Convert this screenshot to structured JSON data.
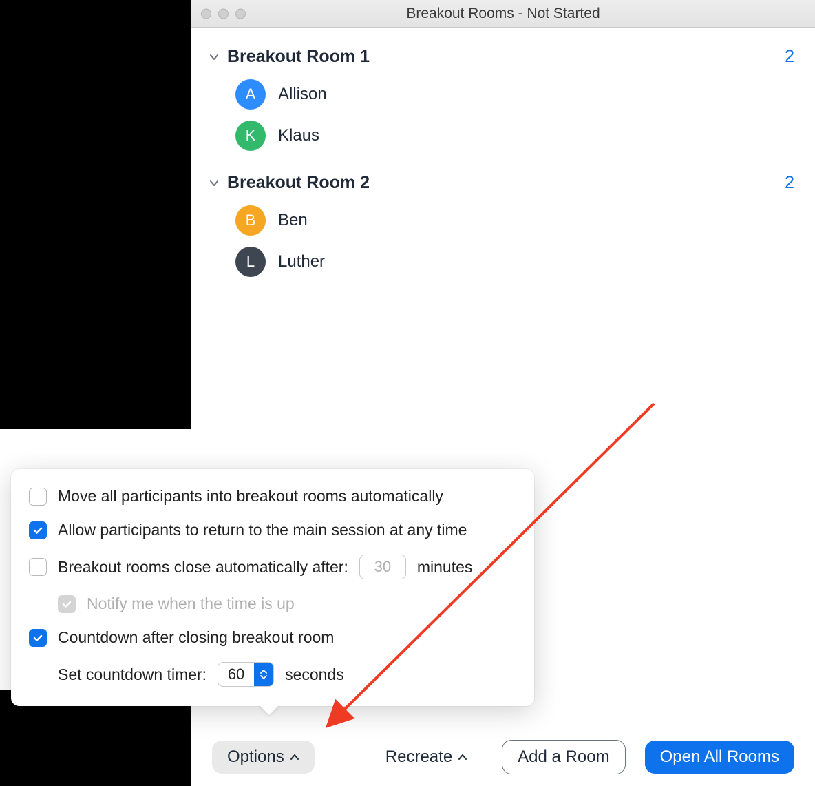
{
  "window": {
    "title": "Breakout Rooms - Not Started"
  },
  "rooms": [
    {
      "name": "Breakout Room 1",
      "count": "2",
      "participants": [
        {
          "initial": "A",
          "name": "Allison",
          "color": "#2d8cff"
        },
        {
          "initial": "K",
          "name": "Klaus",
          "color": "#32b96c"
        }
      ]
    },
    {
      "name": "Breakout Room 2",
      "count": "2",
      "participants": [
        {
          "initial": "B",
          "name": "Ben",
          "color": "#f5a623"
        },
        {
          "initial": "L",
          "name": "Luther",
          "color": "#3d4651"
        }
      ]
    }
  ],
  "options_popup": {
    "move_auto": {
      "label": "Move all participants into breakout rooms automatically",
      "checked": false
    },
    "allow_return": {
      "label": "Allow participants to return to the main session at any time",
      "checked": true
    },
    "close_after_prefix": "Breakout rooms close automatically after:",
    "close_after_value": "30",
    "close_after_suffix": "minutes",
    "close_after_checked": false,
    "notify": {
      "label": "Notify me when the time is up",
      "checked": true,
      "disabled": true
    },
    "countdown": {
      "label": "Countdown after closing breakout room",
      "checked": true
    },
    "set_countdown_prefix": "Set countdown timer:",
    "set_countdown_value": "60",
    "set_countdown_suffix": "seconds"
  },
  "footer": {
    "options": "Options",
    "recreate": "Recreate",
    "add_room": "Add a Room",
    "open_all": "Open All Rooms"
  }
}
